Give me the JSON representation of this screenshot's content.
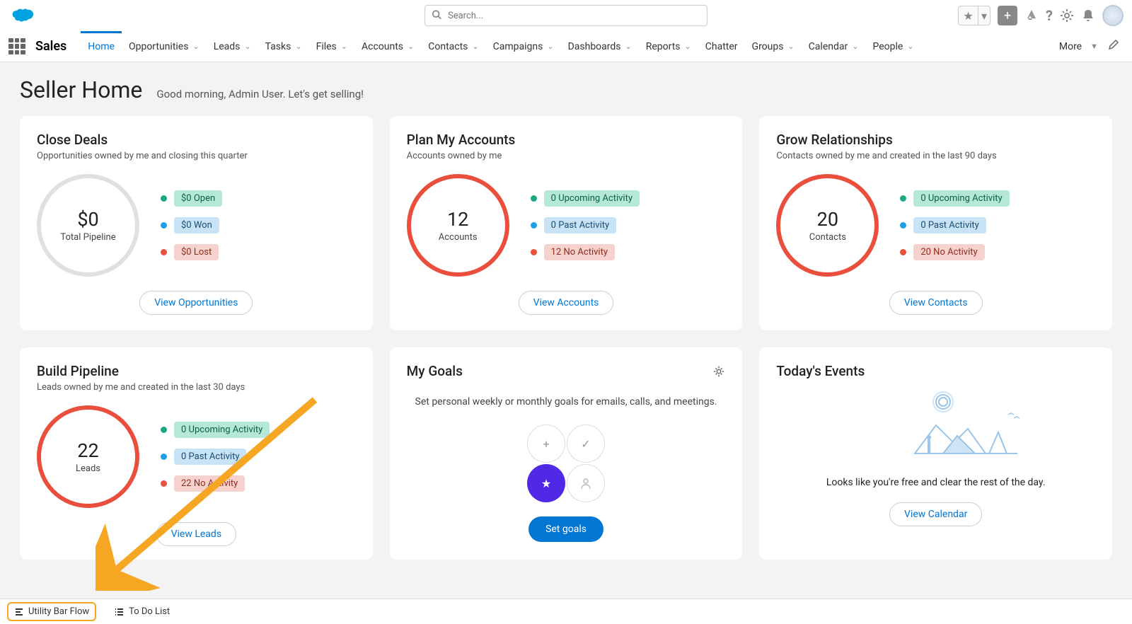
{
  "header": {
    "search_placeholder": "Search...",
    "app_name": "Sales"
  },
  "nav": {
    "items": [
      "Home",
      "Opportunities",
      "Leads",
      "Tasks",
      "Files",
      "Accounts",
      "Contacts",
      "Campaigns",
      "Dashboards",
      "Reports",
      "Chatter",
      "Groups",
      "Calendar",
      "People"
    ],
    "active": "Home",
    "more": "More"
  },
  "page": {
    "title": "Seller Home",
    "subtitle": "Good morning, Admin User. Let's get selling!"
  },
  "close_deals": {
    "title": "Close Deals",
    "sub": "Opportunities owned by me and closing this quarter",
    "circle_val": "$0",
    "circle_lbl": "Total Pipeline",
    "s1": "$0 Open",
    "s2": "$0 Won",
    "s3": "$0 Lost",
    "btn": "View Opportunities"
  },
  "plan_accounts": {
    "title": "Plan My Accounts",
    "sub": "Accounts owned by me",
    "circle_val": "12",
    "circle_lbl": "Accounts",
    "s1": "0 Upcoming Activity",
    "s2": "0 Past Activity",
    "s3": "12 No Activity",
    "btn": "View Accounts"
  },
  "grow_rel": {
    "title": "Grow Relationships",
    "sub": "Contacts owned by me and created in the last 90 days",
    "circle_val": "20",
    "circle_lbl": "Contacts",
    "s1": "0 Upcoming Activity",
    "s2": "0 Past Activity",
    "s3": "20 No Activity",
    "btn": "View Contacts"
  },
  "build_pipeline": {
    "title": "Build Pipeline",
    "sub": "Leads owned by me and created in the last 30 days",
    "circle_val": "22",
    "circle_lbl": "Leads",
    "s1": "0 Upcoming Activity",
    "s2": "0 Past Activity",
    "s3": "22 No Activity",
    "btn": "View Leads"
  },
  "my_goals": {
    "title": "My Goals",
    "text": "Set personal weekly or monthly goals for emails, calls, and meetings.",
    "btn": "Set goals"
  },
  "events": {
    "title": "Today's Events",
    "text": "Looks like you're free and clear the rest of the day.",
    "btn": "View Calendar"
  },
  "utility": {
    "flow": "Utility Bar Flow",
    "todo": "To Do List"
  }
}
